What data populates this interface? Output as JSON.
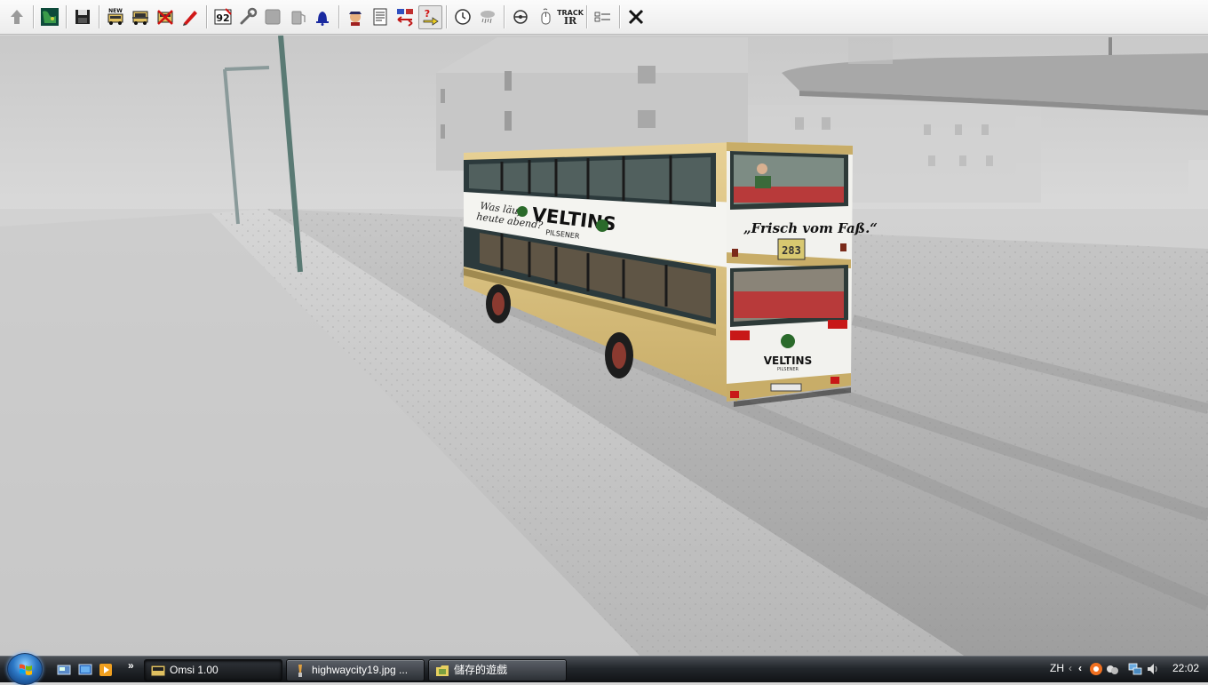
{
  "toolbar": {
    "buttons": [
      {
        "id": "up-arrow",
        "icon": "up-arrow-icon"
      },
      {
        "id": "map",
        "icon": "map-icon"
      },
      {
        "id": "save",
        "icon": "floppy-disk-icon"
      },
      {
        "id": "new-bus",
        "icon": "new-bus-icon",
        "label": "NEW"
      },
      {
        "id": "bus-front",
        "icon": "bus-front-icon"
      },
      {
        "id": "remove-bus",
        "icon": "remove-bus-icon"
      },
      {
        "id": "repair",
        "icon": "red-pen-icon"
      },
      {
        "id": "route",
        "icon": "route-sign-icon",
        "label": "92"
      },
      {
        "id": "tools",
        "icon": "wrench-icon"
      },
      {
        "id": "panel",
        "icon": "panel-icon"
      },
      {
        "id": "fuel",
        "icon": "fuel-icon"
      },
      {
        "id": "bell",
        "icon": "bell-icon"
      },
      {
        "id": "driver",
        "icon": "driver-icon"
      },
      {
        "id": "timetable",
        "icon": "timetable-icon"
      },
      {
        "id": "swap",
        "icon": "swap-icon"
      },
      {
        "id": "help",
        "icon": "help-icon",
        "label": "?"
      },
      {
        "id": "clock",
        "icon": "clock-icon"
      },
      {
        "id": "weather",
        "icon": "weather-icon"
      },
      {
        "id": "view",
        "icon": "view-icon"
      },
      {
        "id": "mouse",
        "icon": "mouse-icon"
      },
      {
        "id": "trackir",
        "icon": "trackir-icon",
        "label_top": "TRACK",
        "label_bottom": "IR"
      },
      {
        "id": "mode",
        "icon": "mode-icon"
      },
      {
        "id": "close",
        "icon": "close-icon"
      }
    ]
  },
  "scene": {
    "bus": {
      "side_ad_slogan_line1": "Was läuft",
      "side_ad_slogan_line2": "heute abend?",
      "brand": "VELTINS",
      "sub_brand": "PILSENER",
      "rear_slogan": "„Frisch vom Faß.“",
      "route_number": "283",
      "rear_brand": "VELTINS",
      "rear_sub_brand": "PILSENER"
    },
    "colors": {
      "bus_body": "#e2c98a",
      "fog": "#d6d6d6",
      "snow": "#cfcfcf"
    }
  },
  "taskbar": {
    "tasks": [
      {
        "label": "Omsi 1.00",
        "icon": "omsi-icon"
      },
      {
        "label": "highwaycity19.jpg ...",
        "icon": "paint-icon"
      },
      {
        "label": "儲存的遊戲",
        "icon": "folder-icon"
      }
    ],
    "language": "ZH",
    "clock": "22:02"
  }
}
